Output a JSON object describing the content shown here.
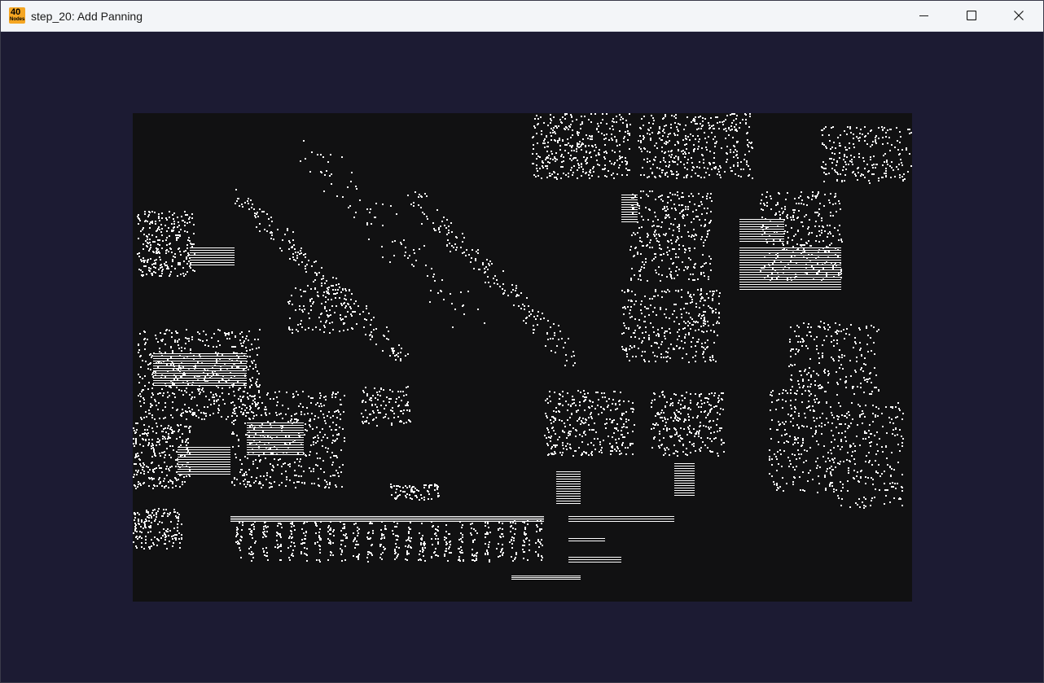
{
  "window": {
    "title": "step_20: Add Panning",
    "app_icon": {
      "name": "app-logo-icon",
      "top_text": "40",
      "bottom_text": "Nodes"
    },
    "controls": {
      "minimize": "minimize-icon",
      "maximize": "maximize-icon",
      "close": "close-icon"
    }
  },
  "colors": {
    "window_background": "#1c1b33",
    "titlebar_background": "#f3f5f8",
    "viewport_background": "#111112",
    "cell_color": "#ffffff"
  }
}
